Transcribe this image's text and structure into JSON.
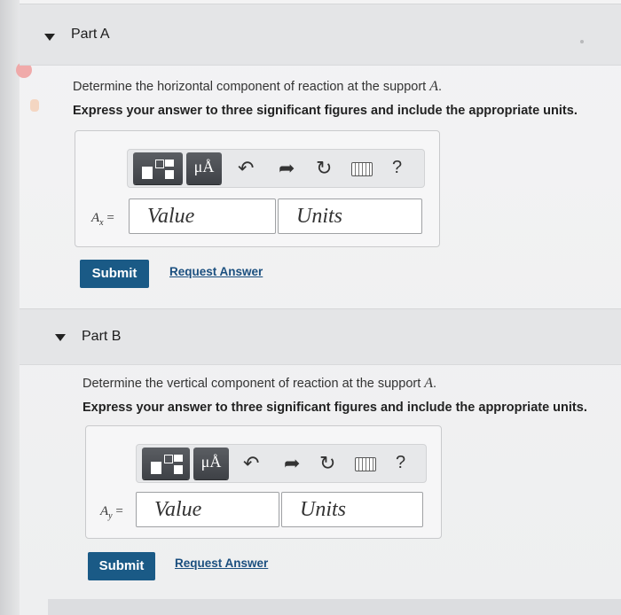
{
  "partA": {
    "title": "Part A",
    "question_prefix": "Determine the horizontal component of reaction at the support ",
    "support_var": "A",
    "question_suffix": ".",
    "instruction": "Express your answer to three significant figures and include the appropriate units.",
    "label_var": "A",
    "label_sub": "x",
    "label_eq": " =",
    "value_placeholder": "Value",
    "units_placeholder": "Units",
    "mu_label": "μÅ",
    "help_symbol": "?",
    "submit_label": "Submit",
    "request_label": "Request Answer"
  },
  "partB": {
    "title": "Part B",
    "question_prefix": "Determine the vertical component of reaction at the support ",
    "support_var": "A",
    "question_suffix": ".",
    "instruction": "Express your answer to three significant figures and include the appropriate units.",
    "label_var": "A",
    "label_sub": "y",
    "label_eq": " =",
    "value_placeholder": "Value",
    "units_placeholder": "Units",
    "mu_label": "μÅ",
    "help_symbol": "?",
    "submit_label": "Submit",
    "request_label": "Request Answer"
  },
  "icons": {
    "caret": "caret-down-icon",
    "templates": "templates-icon",
    "undo": "undo-icon",
    "redo": "redo-icon",
    "reset": "reset-icon",
    "keyboard": "keyboard-icon",
    "help": "help-icon"
  },
  "colors": {
    "submit_bg": "#1a5a86",
    "link": "#1b4f7f",
    "toolbar_btn": "#4a4d52"
  }
}
